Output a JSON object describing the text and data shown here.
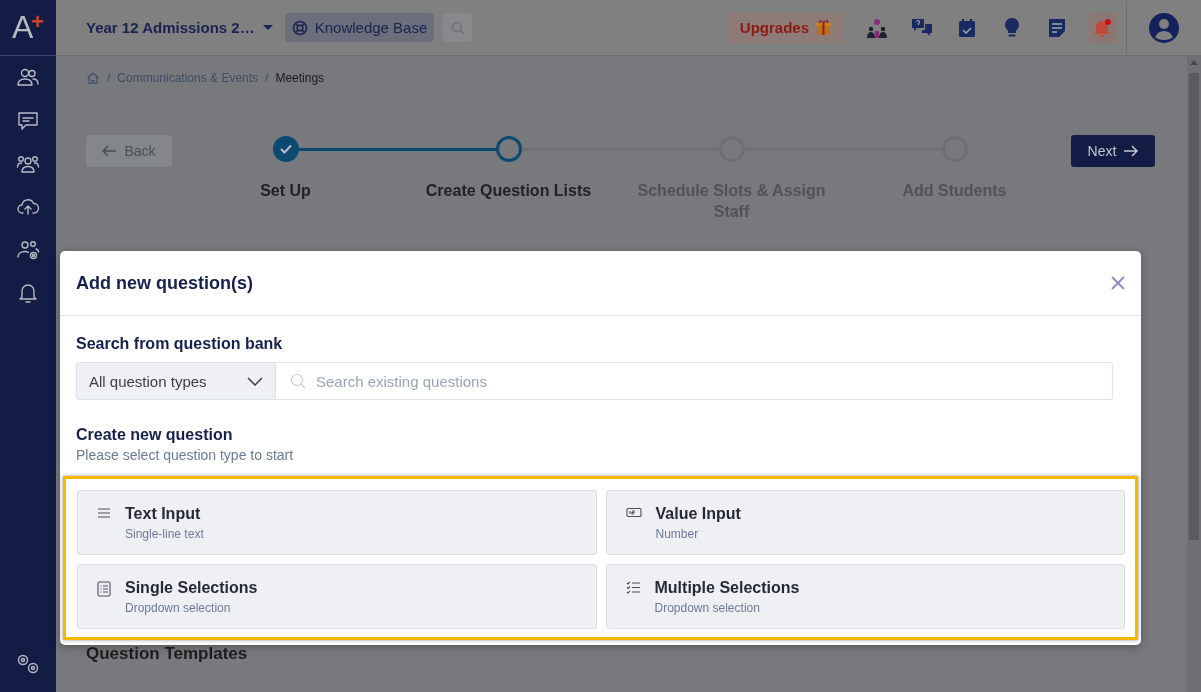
{
  "logo": {
    "letter": "A",
    "mark": "+"
  },
  "topbar": {
    "workspace": "Year 12 Admissions 2…",
    "knowledge_base": "Knowledge Base",
    "upgrades": "Upgrades",
    "notifications_unread": true
  },
  "breadcrumb": {
    "separator": "/",
    "items": [
      "Communications & Events",
      "Meetings"
    ]
  },
  "stepper": {
    "back": "Back",
    "next": "Next",
    "steps": [
      {
        "label": "Set Up",
        "done": true,
        "selected": false
      },
      {
        "label": "Create Question Lists",
        "done": false,
        "selected": true
      },
      {
        "label": "Schedule Slots & Assign Staff",
        "done": false,
        "selected": false
      },
      {
        "label": "Add Students",
        "done": false,
        "selected": false
      }
    ]
  },
  "section_below": {
    "title": "Question Templates"
  },
  "modal": {
    "title": "Add new question(s)",
    "search_label": "Search from question bank",
    "type_select": "All question types",
    "search_placeholder": "Search existing questions",
    "create_title": "Create new question",
    "create_subtitle": "Please select question type to start",
    "highlighted": true,
    "question_types": [
      {
        "kind": "text",
        "title": "Text Input",
        "subtitle": "Single-line text"
      },
      {
        "kind": "number",
        "title": "Value Input",
        "subtitle": "Number"
      },
      {
        "kind": "single",
        "title": "Single Selections",
        "subtitle": "Dropdown selection"
      },
      {
        "kind": "multiple",
        "title": "Multiple Selections",
        "subtitle": "Dropdown selection"
      }
    ]
  }
}
